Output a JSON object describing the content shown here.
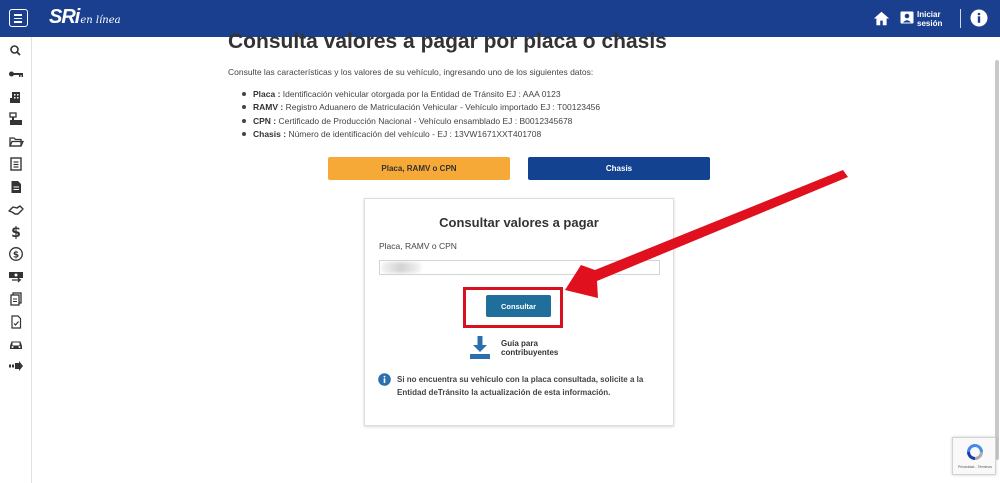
{
  "header": {
    "logo_main": "SRi",
    "logo_sub": "en línea",
    "login_line1": "Iniciar",
    "login_line2": "sesión"
  },
  "sidebar": {
    "icons": [
      "search-icon",
      "key-icon",
      "building-icon",
      "cash-register-icon",
      "folder-open-icon",
      "document-list-icon",
      "document-icon",
      "handshake-icon",
      "dollar-icon",
      "dollar-circle-icon",
      "money-transfer-icon",
      "documents-stack-icon",
      "document-check-icon",
      "car-icon",
      "arrow-right-icon"
    ]
  },
  "page": {
    "title": "Consulta valores a pagar por placa o chasis",
    "intro": "Consulte las características y los valores de su vehículo, ingresando uno de los siguientes datos:",
    "bullets": [
      {
        "term": "Placa :",
        "desc": " Identificación vehicular otorgada por la Entidad de Tránsito EJ : AAA 0123"
      },
      {
        "term": "RAMV :",
        "desc": " Registro Aduanero de Matriculación Vehicular - Vehículo importado EJ : T00123456"
      },
      {
        "term": "CPN :",
        "desc": " Certificado de Producción Nacional - Vehículo ensamblado EJ : B0012345678"
      },
      {
        "term": "Chasis :",
        "desc": " Número de identificación del vehículo - EJ : 13VW1671XXT401708"
      }
    ],
    "tabs": {
      "placa": "Placa, RAMV o CPN",
      "chasis": "Chasis"
    }
  },
  "card": {
    "title": "Consultar valores a pagar",
    "field_label": "Placa, RAMV o CPN",
    "field_value": "",
    "consultar_label": "Consultar",
    "guide_line1": "Guía para",
    "guide_line2": "contribuyentes",
    "note": "Si no encuentra su vehículo con la placa consultada, solicite a la Entidad deTránsito la actualización de esta información."
  },
  "recaptcha": {
    "text": "Privacidad - Términos"
  },
  "colors": {
    "header": "#1a3f8f",
    "tab_placa": "#f6a936",
    "tab_chasis": "#134291",
    "consultar": "#1f6e9c",
    "highlight": "#d9101f",
    "note_icon": "#2c6fad"
  }
}
